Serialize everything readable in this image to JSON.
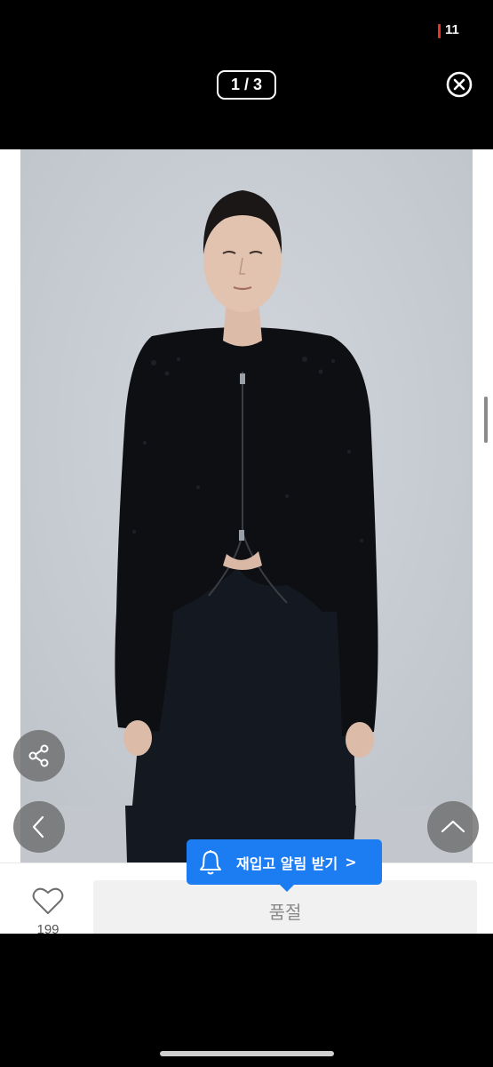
{
  "status_bar": {
    "battery_level": "11"
  },
  "viewer": {
    "page_counter": "1 / 3"
  },
  "product": {
    "like_count": "199",
    "soldout_label": "품절"
  },
  "restock_tooltip": {
    "label": "재입고 알림 받기",
    "chevron": ">"
  },
  "icons": {
    "close": "close-icon",
    "share": "share-icon",
    "prev": "chevron-left-icon",
    "top": "chevron-up-icon",
    "heart": "heart-icon",
    "bell": "bell-icon"
  },
  "colors": {
    "accent": "#1c7cf2",
    "battery_low": "#e5332a",
    "photo_bg": "#c8ccd3"
  }
}
